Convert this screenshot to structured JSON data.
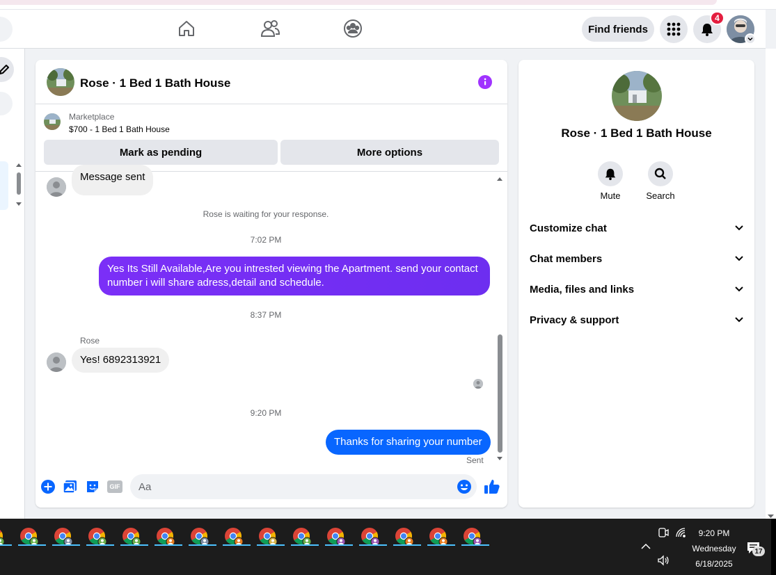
{
  "topnav": {
    "find_friends": "Find friends",
    "notification_count": "4",
    "icons": [
      "home-icon",
      "friends-icon",
      "groups-icon",
      "menu-grid-icon",
      "bell-icon"
    ]
  },
  "chat": {
    "title": "Rose · 1 Bed 1 Bath House",
    "marketplace_label": "Marketplace",
    "listing": "$700 - 1 Bed 1 Bath House",
    "mark_pending": "Mark as pending",
    "more_options": "More options",
    "messages": {
      "sent_prev": "Message sent",
      "waiting": "Rose is waiting for your response.",
      "time1": "7:02 PM",
      "out1": "Yes Its Still Available,Are you intrested viewing the Apartment. send your contact number i will share adress,detail and schedule.",
      "time2": "8:37 PM",
      "sender": "Rose",
      "in1": "Yes! 6892313921",
      "time3": "9:20 PM",
      "out2": "Thanks for sharing your number",
      "status": "Sent"
    },
    "composer": {
      "placeholder": "Aa",
      "gif": "GIF"
    },
    "colors": {
      "accent": "#0866ff",
      "purple": "#7b2ff7",
      "info": "#a033ff"
    }
  },
  "info_panel": {
    "title": "Rose · 1 Bed 1 Bath House",
    "mute": "Mute",
    "search": "Search",
    "sections": [
      "Customize chat",
      "Chat members",
      "Media, files and links",
      "Privacy & support"
    ]
  },
  "taskbar": {
    "time": "9:20 PM",
    "day": "Wednesday",
    "date": "6/18/2025",
    "notifications": "17",
    "app_count": 15
  }
}
